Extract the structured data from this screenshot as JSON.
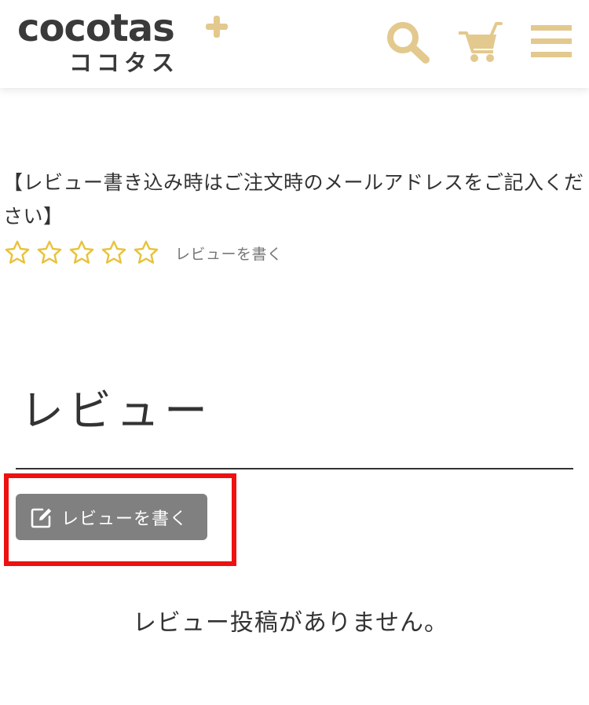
{
  "header": {
    "logo_text": "cocotas",
    "logo_plus": "+",
    "logo_subtext": "ココタス",
    "icons": [
      "search-icon",
      "cart-icon",
      "menu-icon"
    ],
    "accent_color": "#e3c98e"
  },
  "product": {
    "notice": "【レビュー書き込み時はご注文時のメールアドレスをご記入ください】",
    "rating": {
      "stars_filled": 0,
      "stars_total": 5,
      "star_color": "#e8c23a"
    },
    "write_review_link": "レビューを書く"
  },
  "reviews": {
    "heading": "レビュー",
    "write_button": {
      "label": "レビューを書く",
      "icon": "edit-icon",
      "background": "#808080"
    },
    "highlight_color": "#ee1111",
    "empty_message": "レビュー投稿がありません。"
  }
}
